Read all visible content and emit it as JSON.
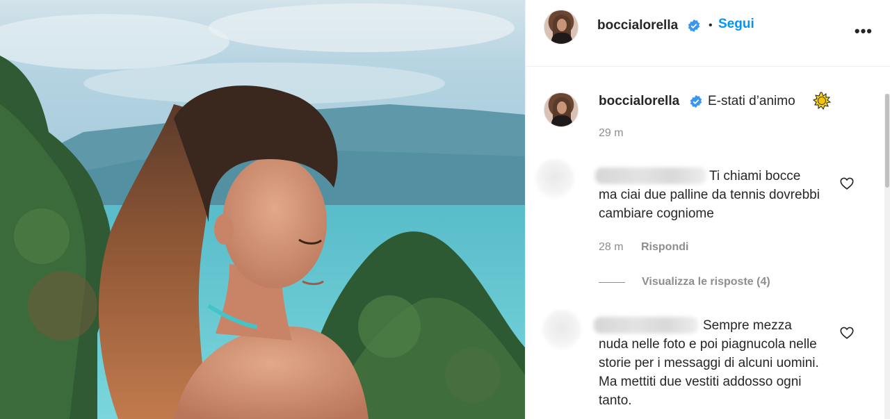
{
  "post": {
    "username": "boccialorella",
    "follow_label": "Segui",
    "dot": "•",
    "more_label": "•••"
  },
  "caption": {
    "username": "boccialorella",
    "text": "E-stati d’animo",
    "time": "29 m"
  },
  "comments": [
    {
      "text": "Ti chiami bocce ma ciai due palline da tennis dovrebbi cambiare cogniome",
      "time": "28 m",
      "reply_label": "Rispondi",
      "view_replies_label": "Visualizza le risposte (4)"
    },
    {
      "text": "Sempre mezza nuda nelle foto e poi piagnucola nelle storie per i messaggi di alcuni uomini. Ma mettiti due vestiti addosso ogni tanto."
    }
  ],
  "colors": {
    "accent": "#0095f6",
    "text": "#262626",
    "muted": "#8e8e8e"
  },
  "icons": {
    "verified": "verified-badge-icon",
    "sun": "sun-emoji-icon",
    "heart": "heart-outline-icon",
    "more": "more-options-icon"
  }
}
